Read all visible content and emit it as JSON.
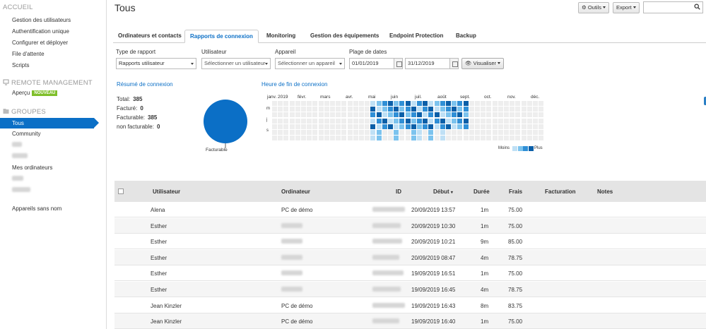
{
  "sidebar": {
    "accueil_title": "ACCUEIL",
    "accueil_items": [
      "Gestion des utilisateurs",
      "Authentification unique",
      "Configurer et déployer",
      "File d'attente",
      "Scripts"
    ],
    "remote_title": "REMOTE MANAGEMENT",
    "apercu_label": "Aperçu",
    "apercu_badge": "NOUVEAU",
    "groupes_title": "GROUPES",
    "group_tous": "Tous",
    "group_community": "Community",
    "group_mes_ordinateurs": "Mes ordinateurs",
    "appareils_sans_nom": "Appareils sans nom"
  },
  "header": {
    "title": "Tous",
    "outils_label": "Outils",
    "export_label": "Export",
    "search_placeholder": ""
  },
  "tabs": [
    "Ordinateurs et contacts",
    "Rapports de connexion",
    "Monitoring",
    "Gestion des équipements",
    "Endpoint Protection",
    "Backup"
  ],
  "filters": {
    "type_label": "Type de rapport",
    "type_value": "Rapports utilisateur",
    "user_label": "Utilisateur",
    "user_placeholder": "Sélectionner un utilisateur",
    "device_label": "Appareil",
    "device_placeholder": "Sélectionner un appareil",
    "dates_label": "Plage de dates",
    "date_start": "01/01/2019",
    "date_end": "31/12/2019",
    "view_label": "Visualiser"
  },
  "summary": {
    "title": "Résumé de connexion",
    "total_label": "Total:",
    "total_value": "385",
    "billed_label": "Facturé:",
    "billed_value": "0",
    "billable_label": "Facturable:",
    "billable_value": "385",
    "nonbillable_label": "non facturable:",
    "nonbillable_value": "0",
    "pie_label": "Facturable"
  },
  "heatmap": {
    "title": "Heure de fin de connexion",
    "months": [
      "janv. 2019",
      "févr.",
      "mars",
      "avr.",
      "mai",
      "juin",
      "juil.",
      "août",
      "sept.",
      "oct.",
      "nov.",
      "déc."
    ],
    "days": [
      "m",
      "j",
      "s"
    ],
    "legend_less": "Moins",
    "legend_more": "Plus",
    "colors": [
      "#eeeeee",
      "#bfe0f5",
      "#7cc3ee",
      "#2f8fd6",
      "#0b5fa8"
    ]
  },
  "table": {
    "headers": [
      "Utilisateur",
      "Ordinateur",
      "ID",
      "Début",
      "Durée",
      "Frais",
      "Facturation",
      "Notes"
    ],
    "sort_marker": "▾",
    "rows": [
      {
        "user": "Alena",
        "computer": "PC de démo",
        "start": "20/09/2019 13:57",
        "duration": "1m",
        "fee": "75.00"
      },
      {
        "user": "Esther",
        "computer": "",
        "start": "20/09/2019 10:30",
        "duration": "1m",
        "fee": "75.00"
      },
      {
        "user": "Esther",
        "computer": "",
        "start": "20/09/2019 10:21",
        "duration": "9m",
        "fee": "85.00"
      },
      {
        "user": "Esther",
        "computer": "",
        "start": "20/09/2019 08:47",
        "duration": "4m",
        "fee": "78.75"
      },
      {
        "user": "Esther",
        "computer": "",
        "start": "19/09/2019 16:51",
        "duration": "1m",
        "fee": "75.00"
      },
      {
        "user": "Esther",
        "computer": "",
        "start": "19/09/2019 16:45",
        "duration": "4m",
        "fee": "78.75"
      },
      {
        "user": "Jean Kinzler",
        "computer": "PC de démo",
        "start": "19/09/2019 16:43",
        "duration": "8m",
        "fee": "83.75"
      },
      {
        "user": "Jean Kinzler",
        "computer": "PC de démo",
        "start": "19/09/2019 16:40",
        "duration": "1m",
        "fee": "75.00"
      }
    ]
  },
  "colors": {
    "accent": "#0b6fc6",
    "badge": "#7fbf2a",
    "pie": "#0b6fc6"
  }
}
